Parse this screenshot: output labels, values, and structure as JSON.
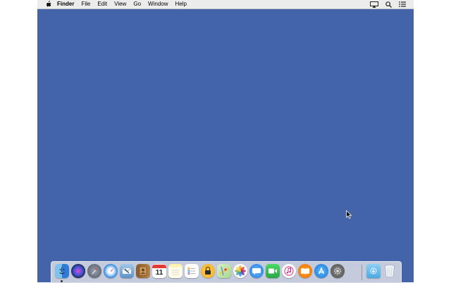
{
  "menubar": {
    "apple_icon": "apple-icon",
    "app_name": "Finder",
    "items": [
      "File",
      "Edit",
      "View",
      "Go",
      "Window",
      "Help"
    ],
    "status_icons": [
      "airplay-icon",
      "spotlight-search-icon",
      "notification-center-icon"
    ]
  },
  "desktop": {
    "background_color": "#4364a8"
  },
  "dock": {
    "apps": [
      {
        "name": "Finder",
        "icon": "finder-icon",
        "running": true
      },
      {
        "name": "Siri",
        "icon": "siri-icon"
      },
      {
        "name": "Launchpad",
        "icon": "launchpad-icon"
      },
      {
        "name": "Safari",
        "icon": "safari-icon"
      },
      {
        "name": "Mail",
        "icon": "mail-icon"
      },
      {
        "name": "Contacts",
        "icon": "contacts-icon"
      },
      {
        "name": "Calendar",
        "icon": "calendar-icon",
        "text": "11"
      },
      {
        "name": "Notes",
        "icon": "notes-icon"
      },
      {
        "name": "Reminders",
        "icon": "reminders-icon"
      },
      {
        "name": "Keychain Access",
        "icon": "keychain-lock-icon"
      },
      {
        "name": "Maps",
        "icon": "maps-icon"
      },
      {
        "name": "Photos",
        "icon": "photos-icon"
      },
      {
        "name": "Messages",
        "icon": "messages-icon"
      },
      {
        "name": "FaceTime",
        "icon": "facetime-icon"
      },
      {
        "name": "iTunes",
        "icon": "itunes-icon"
      },
      {
        "name": "iBooks",
        "icon": "ibooks-icon"
      },
      {
        "name": "App Store",
        "icon": "app-store-icon"
      },
      {
        "name": "System Preferences",
        "icon": "system-preferences-icon"
      }
    ],
    "folders": [
      {
        "name": "Downloads",
        "icon": "downloads-folder-icon"
      },
      {
        "name": "Trash",
        "icon": "trash-icon"
      }
    ]
  }
}
